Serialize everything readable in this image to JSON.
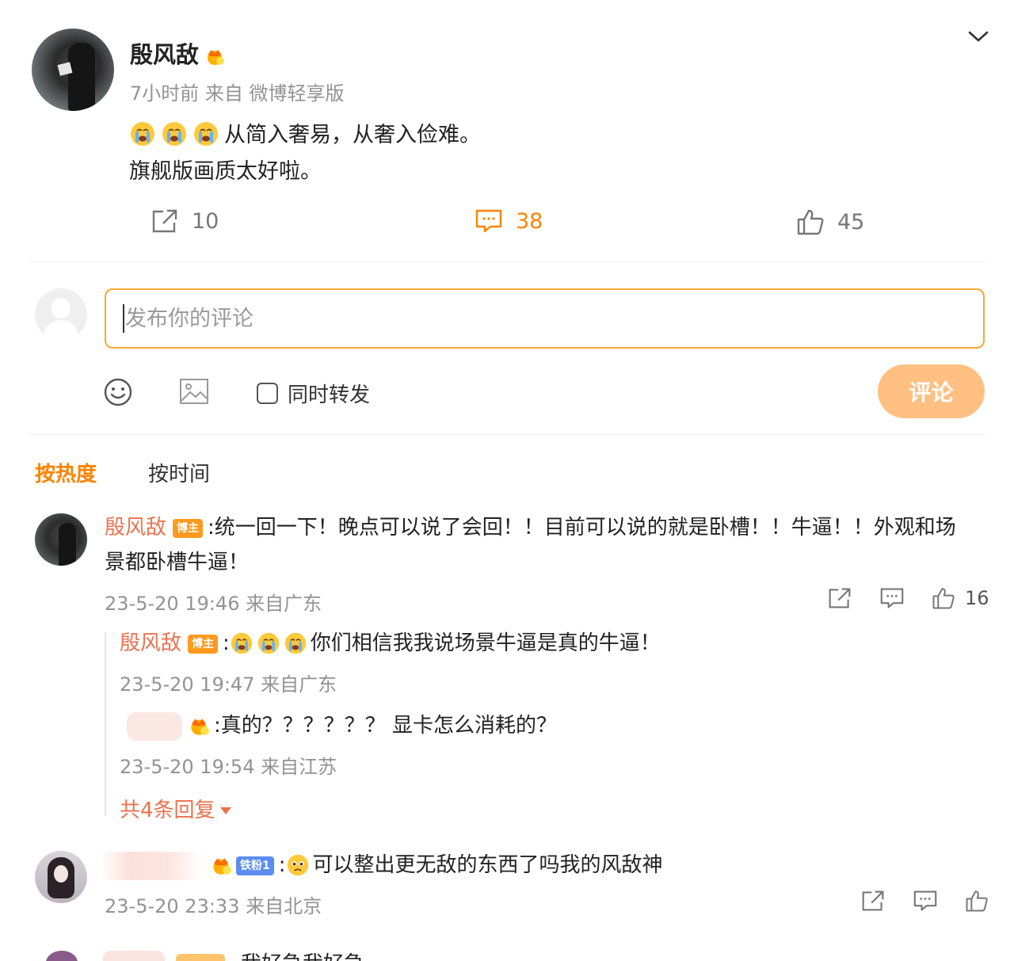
{
  "post": {
    "author": "殷风敌",
    "meta": "7小时前  来自  微博轻享版",
    "text_line1": "从简入奢易，从奢入俭难。",
    "text_line2": "旗舰版画质太好啦。",
    "emoji": "crying-face",
    "stats": {
      "forwards": "10",
      "comments": "38",
      "likes": "45"
    }
  },
  "composer": {
    "placeholder": "发布你的评论",
    "forward_label": "同时转发",
    "submit_label": "评论"
  },
  "sort_tabs": {
    "hot": "按热度",
    "time": "按时间"
  },
  "comments": [
    {
      "name": "殷风敌",
      "badge": "博主",
      "text_line1": ":统一回一下！晚点可以说了会回！！目前可以说的就是卧槽！！牛逼！！外观和场",
      "text_line2": "景都卧槽牛逼！",
      "time": "23-5-20 19:46 来自广东",
      "likes": "16",
      "replies": [
        {
          "name": "殷风敌",
          "badge": "博主",
          "text": "你们相信我我说场景牛逼是真的牛逼！",
          "time": "23-5-20 19:47 来自广东"
        },
        {
          "name": "",
          "text": ":真的？？？？？？ 显卡怎么消耗的？",
          "time": "23-5-20 19:54 来自江苏"
        }
      ],
      "more_replies": "共4条回复"
    },
    {
      "name": "",
      "badge": "铁粉1",
      "text": "可以整出更无敌的东西了吗我的风敌神",
      "time": "23-5-20 23:33 来自北京"
    }
  ],
  "partial_text": "我好急我好急",
  "colors": {
    "accent": "#ff8200",
    "name": "#eb7350",
    "border": "#ffa732",
    "button": "#ffc082"
  }
}
